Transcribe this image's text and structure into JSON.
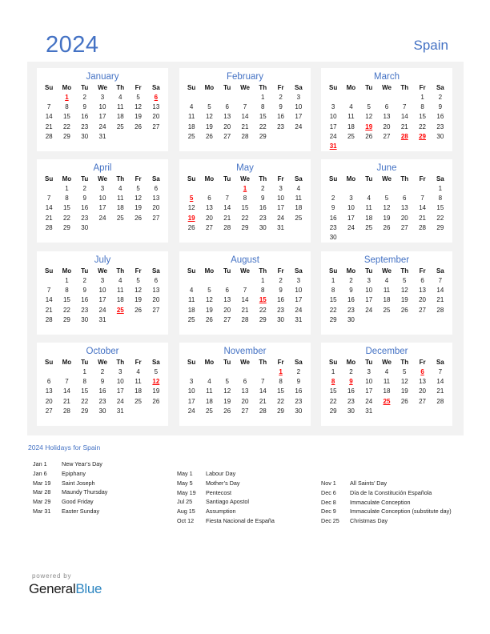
{
  "header": {
    "year": "2024",
    "country": "Spain"
  },
  "weekdays": [
    "Su",
    "Mo",
    "Tu",
    "We",
    "Th",
    "Fr",
    "Sa"
  ],
  "colors": {
    "accent": "#4472C4",
    "holiday": "#FF0000",
    "panel_bg": "#F2F2F2"
  },
  "months": [
    {
      "name": "January",
      "start": 1,
      "days": 31,
      "holidays": [
        1,
        6
      ]
    },
    {
      "name": "February",
      "start": 4,
      "days": 29,
      "holidays": []
    },
    {
      "name": "March",
      "start": 5,
      "days": 31,
      "holidays": [
        19,
        28,
        29,
        31
      ]
    },
    {
      "name": "April",
      "start": 1,
      "days": 30,
      "holidays": []
    },
    {
      "name": "May",
      "start": 3,
      "days": 31,
      "holidays": [
        1,
        5,
        19
      ]
    },
    {
      "name": "June",
      "start": 6,
      "days": 30,
      "holidays": []
    },
    {
      "name": "July",
      "start": 1,
      "days": 31,
      "holidays": [
        25
      ]
    },
    {
      "name": "August",
      "start": 4,
      "days": 31,
      "holidays": [
        15
      ]
    },
    {
      "name": "September",
      "start": 0,
      "days": 30,
      "holidays": []
    },
    {
      "name": "October",
      "start": 2,
      "days": 31,
      "holidays": [
        12
      ]
    },
    {
      "name": "November",
      "start": 5,
      "days": 30,
      "holidays": [
        1
      ]
    },
    {
      "name": "December",
      "start": 0,
      "days": 31,
      "holidays": [
        6,
        8,
        9,
        25
      ]
    }
  ],
  "holidays_title": "2024 Holidays for Spain",
  "holiday_columns": [
    [
      {
        "date": "Jan 1",
        "name": "New Year’s Day"
      },
      {
        "date": "Jan 6",
        "name": "Epiphany"
      },
      {
        "date": "Mar 19",
        "name": "Saint Joseph"
      },
      {
        "date": "Mar 28",
        "name": "Maundy Thursday"
      },
      {
        "date": "Mar 29",
        "name": "Good Friday"
      },
      {
        "date": "Mar 31",
        "name": "Easter Sunday"
      }
    ],
    [
      {
        "date": "May 1",
        "name": "Labour Day"
      },
      {
        "date": "May 5",
        "name": "Mother’s Day"
      },
      {
        "date": "May 19",
        "name": "Pentecost"
      },
      {
        "date": "Jul 25",
        "name": "Santiago Apostol"
      },
      {
        "date": "Aug 15",
        "name": "Assumption"
      },
      {
        "date": "Oct 12",
        "name": "Fiesta Nacional de España"
      }
    ],
    [
      {
        "date": "Nov 1",
        "name": "All Saints’ Day"
      },
      {
        "date": "Dec 6",
        "name": "Día de la Constitución Española"
      },
      {
        "date": "Dec 8",
        "name": "Immaculate Conception"
      },
      {
        "date": "Dec 9",
        "name": "Immaculate Conception (substitute day)"
      },
      {
        "date": "Dec 25",
        "name": "Christmas Day"
      }
    ]
  ],
  "footer": {
    "powered_by": "powered by",
    "brand_general": "General",
    "brand_blue": "Blue"
  }
}
